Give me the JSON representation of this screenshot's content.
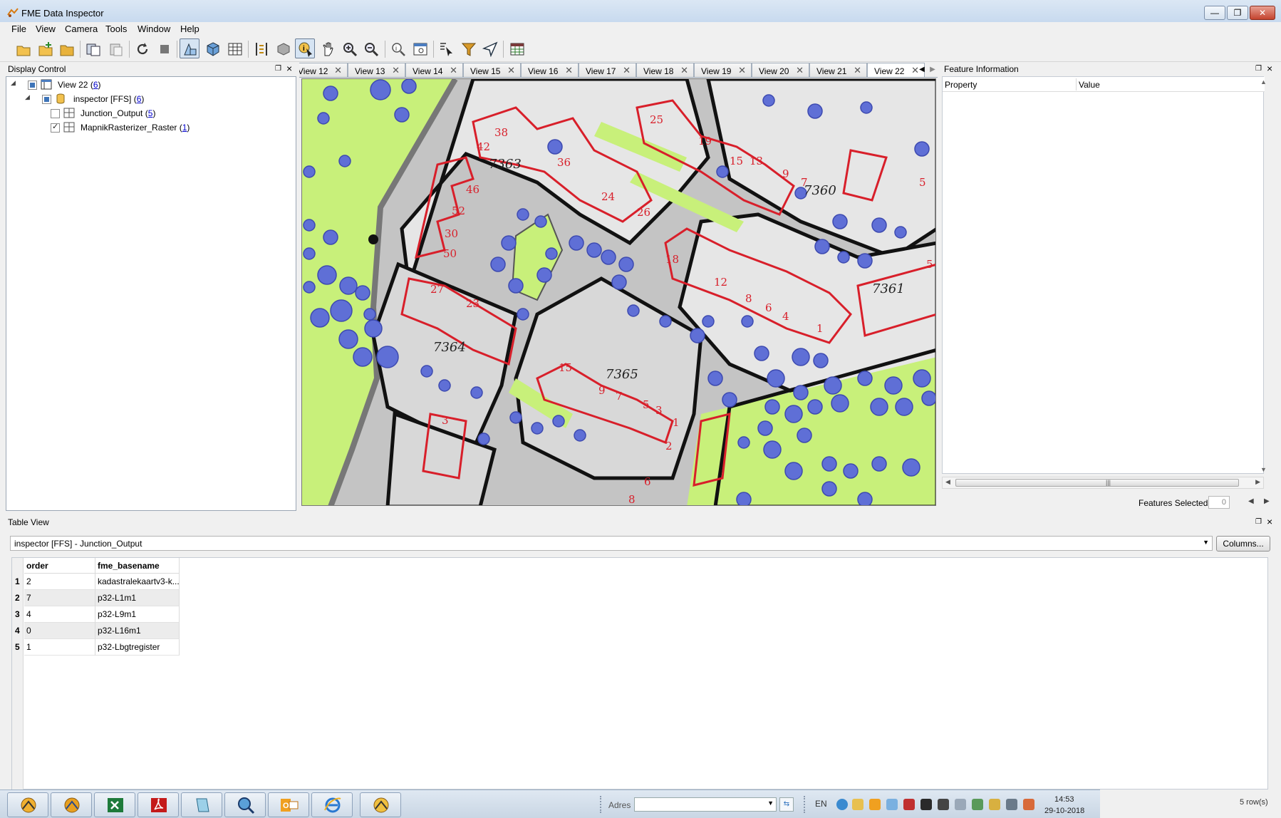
{
  "window": {
    "title": "FME Data Inspector"
  },
  "menu": {
    "file": "File",
    "view": "View",
    "camera": "Camera",
    "tools": "Tools",
    "window": "Window",
    "help": "Help"
  },
  "toolbar": {
    "buttons": [
      "open-icon",
      "add-dataset-icon",
      "open-folder-icon",
      "copy-view-icon",
      "paste-view-icon",
      "refresh-icon",
      "stop-icon",
      "2d-view-icon",
      "3d-view-icon",
      "table-icon",
      "measure-icon",
      "background-map-icon",
      "select-icon",
      "pan-icon",
      "zoom-in-icon",
      "zoom-out-icon",
      "zoom-extents-icon",
      "zoom-selection-icon",
      "select-features-icon",
      "filter-icon",
      "navigate-icon",
      "table-view-icon"
    ]
  },
  "display_control": {
    "title": "Display Control",
    "tree": [
      {
        "label": "View 22",
        "count": "6"
      },
      {
        "label": "inspector [FFS]",
        "count": "6"
      },
      {
        "label": "Junction_Output",
        "count": "5",
        "checked": false
      },
      {
        "label": "MapnikRasterizer_Raster",
        "count": "1",
        "checked": true
      }
    ]
  },
  "tabs": [
    {
      "label": "View 12"
    },
    {
      "label": "View 13"
    },
    {
      "label": "View 14"
    },
    {
      "label": "View 15"
    },
    {
      "label": "View 16"
    },
    {
      "label": "View 17"
    },
    {
      "label": "View 18"
    },
    {
      "label": "View 19"
    },
    {
      "label": "View 20"
    },
    {
      "label": "View 21"
    },
    {
      "label": "View 22",
      "selected": true
    }
  ],
  "map": {
    "parcel_labels": [
      "7363",
      "7360",
      "7361",
      "7364",
      "7365"
    ],
    "house_numbers": [
      "38",
      "36",
      "30",
      "24",
      "26",
      "42",
      "46",
      "50",
      "52",
      "25",
      "19",
      "15",
      "13",
      "9",
      "7",
      "5",
      "18",
      "12",
      "8",
      "6",
      "4",
      "1",
      "27",
      "23",
      "15",
      "9",
      "7",
      "5",
      "3",
      "3",
      "1",
      "2",
      "6",
      "8",
      "5"
    ],
    "colors": {
      "green": "#c8f07a",
      "road": "#c4c4c4",
      "parcel": "#e6e6e6",
      "buildings": "#d81f2a",
      "trees": "#5f6fd6"
    }
  },
  "feature_info": {
    "title": "Feature Information",
    "col_property": "Property",
    "col_value": "Value",
    "features_selected_label": "Features Selected:",
    "features_selected_value": "0"
  },
  "table_view": {
    "title": "Table View",
    "source": "inspector [FFS] - Junction_Output",
    "columns_button": "Columns...",
    "headers": [
      "order",
      "fme_basename"
    ],
    "rows": [
      {
        "n": "1",
        "order": "2",
        "basename": "kadastralekaartv3-k..."
      },
      {
        "n": "2",
        "order": "7",
        "basename": "p32-L1m1"
      },
      {
        "n": "3",
        "order": "4",
        "basename": "p32-L9m1"
      },
      {
        "n": "4",
        "order": "0",
        "basename": "p32-L16m1"
      },
      {
        "n": "5",
        "order": "1",
        "basename": "p32-Lbgtregister"
      }
    ],
    "row_count": "5 row(s)"
  },
  "taskbar": {
    "apps": [
      "fme-workbench-icon",
      "fme-inspector-icon",
      "excel-icon",
      "acrobat-icon",
      "notepad-icon",
      "search-icon",
      "outlook-icon",
      "internet-explorer-icon",
      "fme-data-inspector-icon"
    ],
    "address_label": "Adres",
    "language": "EN",
    "time": "14:53",
    "date": "29-10-2018"
  }
}
